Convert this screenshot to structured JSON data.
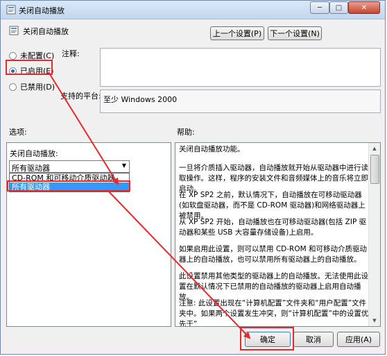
{
  "window": {
    "title": "关闭自动播放",
    "header": "关闭自动播放",
    "close_glyph": "✕",
    "min_glyph": "─",
    "max_glyph": "□"
  },
  "nav": {
    "prev": "上一个设置(P)",
    "next": "下一个设置(N)"
  },
  "radios": [
    {
      "label": "未配置(C)",
      "checked": false
    },
    {
      "label": "已启用(E)",
      "checked": true
    },
    {
      "label": "已禁用(D)",
      "checked": false
    }
  ],
  "comment_label": "注释:",
  "platform": {
    "label": "支持的平台:",
    "value": "至少 Windows 2000"
  },
  "options": {
    "label": "选项:",
    "field_label": "关闭自动播放:",
    "selected": "所有驱动器",
    "dropdown_options": [
      "CD-ROM 和可移动介质驱动器",
      "所有驱动器"
    ]
  },
  "help": {
    "label": "帮助:",
    "paragraphs": [
      "关闭自动播放功能。",
      "一旦将介质插入驱动器，自动播放就开始从驱动器中进行读取操作。这样，程序的安装文件和音频媒体上的音乐将立即启动。",
      "在 XP SP2 之前，默认情况下，自动播放在可移动驱动器(如软盘驱动器，而不是 CD-ROM 驱动器)和网络驱动器上被禁用。",
      "从 XP SP2 开始，自动播放也在可移动驱动器(包括 ZIP 驱动器和某些 USB 大容量存储设备)上启用。",
      "如果启用此设置，则可以禁用 CD-ROM 和可移动介质驱动器上的自动播放，也可以禁用所有驱动器上的自动播放。",
      "此设置禁用其他类型的驱动器上的自动播放。无法使用此设置在默认情况下已禁用的自动播放的驱动器上启用自动播放。",
      "注意: 此设置出现在“计算机配置”文件夹和“用户配置”文件夹中。如果两个设置发生冲突，则“计算机配置”中的设置优先于“"
    ]
  },
  "footer": {
    "ok": "确定",
    "cancel": "取消",
    "apply": "应用(A)"
  },
  "colors": {
    "accent": "#3399ff",
    "annotation": "#e8282c"
  }
}
